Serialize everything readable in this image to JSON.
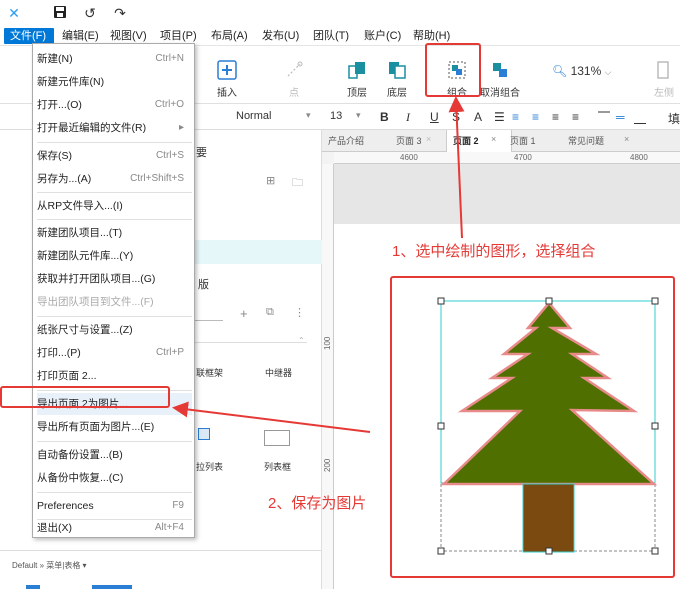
{
  "titlebar": {
    "app_icon": "axure-logo-icon",
    "save_icon": "save-icon",
    "undo_icon": "undo-icon",
    "redo_icon": "redo-icon"
  },
  "menubar": {
    "items": [
      "文件(F)",
      "编辑(E)",
      "视图(V)",
      "项目(P)",
      "布局(A)",
      "发布(U)",
      "团队(T)",
      "账户(C)",
      "帮助(H)"
    ]
  },
  "toolbar": {
    "insert": "插入",
    "point": "点",
    "top_layer": "顶层",
    "bottom_layer": "底层",
    "group": "组合",
    "ungroup": "取消组合",
    "zoom": "131%",
    "left": "左侧",
    "right_cut": "填"
  },
  "formatbar": {
    "style": "Normal",
    "font_size": "13"
  },
  "left_panel": {
    "outline_title": "要",
    "library_title": "版",
    "widget_frame": "联框架",
    "widget_relay": "中继器",
    "widget_list": "拉列表",
    "widget_listbox": "列表框",
    "footer": "Default » 菜单|表格 ▾"
  },
  "tabs": [
    "产品介绍",
    "页面 3",
    "页面 2",
    "页面 1",
    "常见问题"
  ],
  "ruler": {
    "top": [
      "4600",
      "4700",
      "4800"
    ],
    "left": [
      "100",
      "200"
    ]
  },
  "file_menu": {
    "items": [
      {
        "label": "新建(N)",
        "shortcut": "Ctrl+N"
      },
      {
        "label": "新建元件库(N)",
        "shortcut": ""
      },
      {
        "label": "打开...(O)",
        "shortcut": "Ctrl+O"
      },
      {
        "label": "打开最近编辑的文件(R)",
        "shortcut": "▸"
      },
      {
        "label": "保存(S)",
        "shortcut": "Ctrl+S"
      },
      {
        "label": "另存为...(A)",
        "shortcut": "Ctrl+Shift+S"
      },
      {
        "label": "从RP文件导入...(I)",
        "shortcut": ""
      },
      {
        "label": "新建团队项目...(T)",
        "shortcut": ""
      },
      {
        "label": "新建团队元件库...(Y)",
        "shortcut": ""
      },
      {
        "label": "获取并打开团队项目...(G)",
        "shortcut": ""
      },
      {
        "label": "导出团队项目到文件...(F)",
        "shortcut": ""
      },
      {
        "label": "纸张尺寸与设置...(Z)",
        "shortcut": ""
      },
      {
        "label": "打印...(P)",
        "shortcut": "Ctrl+P"
      },
      {
        "label": "打印页面 2...",
        "shortcut": ""
      },
      {
        "label": "导出页面 2为图片...",
        "shortcut": ""
      },
      {
        "label": "导出所有页面为图片...(E)",
        "shortcut": ""
      },
      {
        "label": "自动备份设置...(B)",
        "shortcut": ""
      },
      {
        "label": "从备份中恢复...(C)",
        "shortcut": ""
      },
      {
        "label": "Preferences",
        "shortcut": "F9"
      },
      {
        "label": "退出(X)",
        "shortcut": "Alt+F4"
      }
    ]
  },
  "annotations": {
    "step1": "1、选中绘制的图形，选择组合",
    "step2": "2、保存为图片"
  },
  "colors": {
    "accent": "#0078d7",
    "annotation": "#e53935",
    "tree": "#4f6f00",
    "tree_outline": "#e88a8a",
    "trunk": "#7a4a10"
  }
}
